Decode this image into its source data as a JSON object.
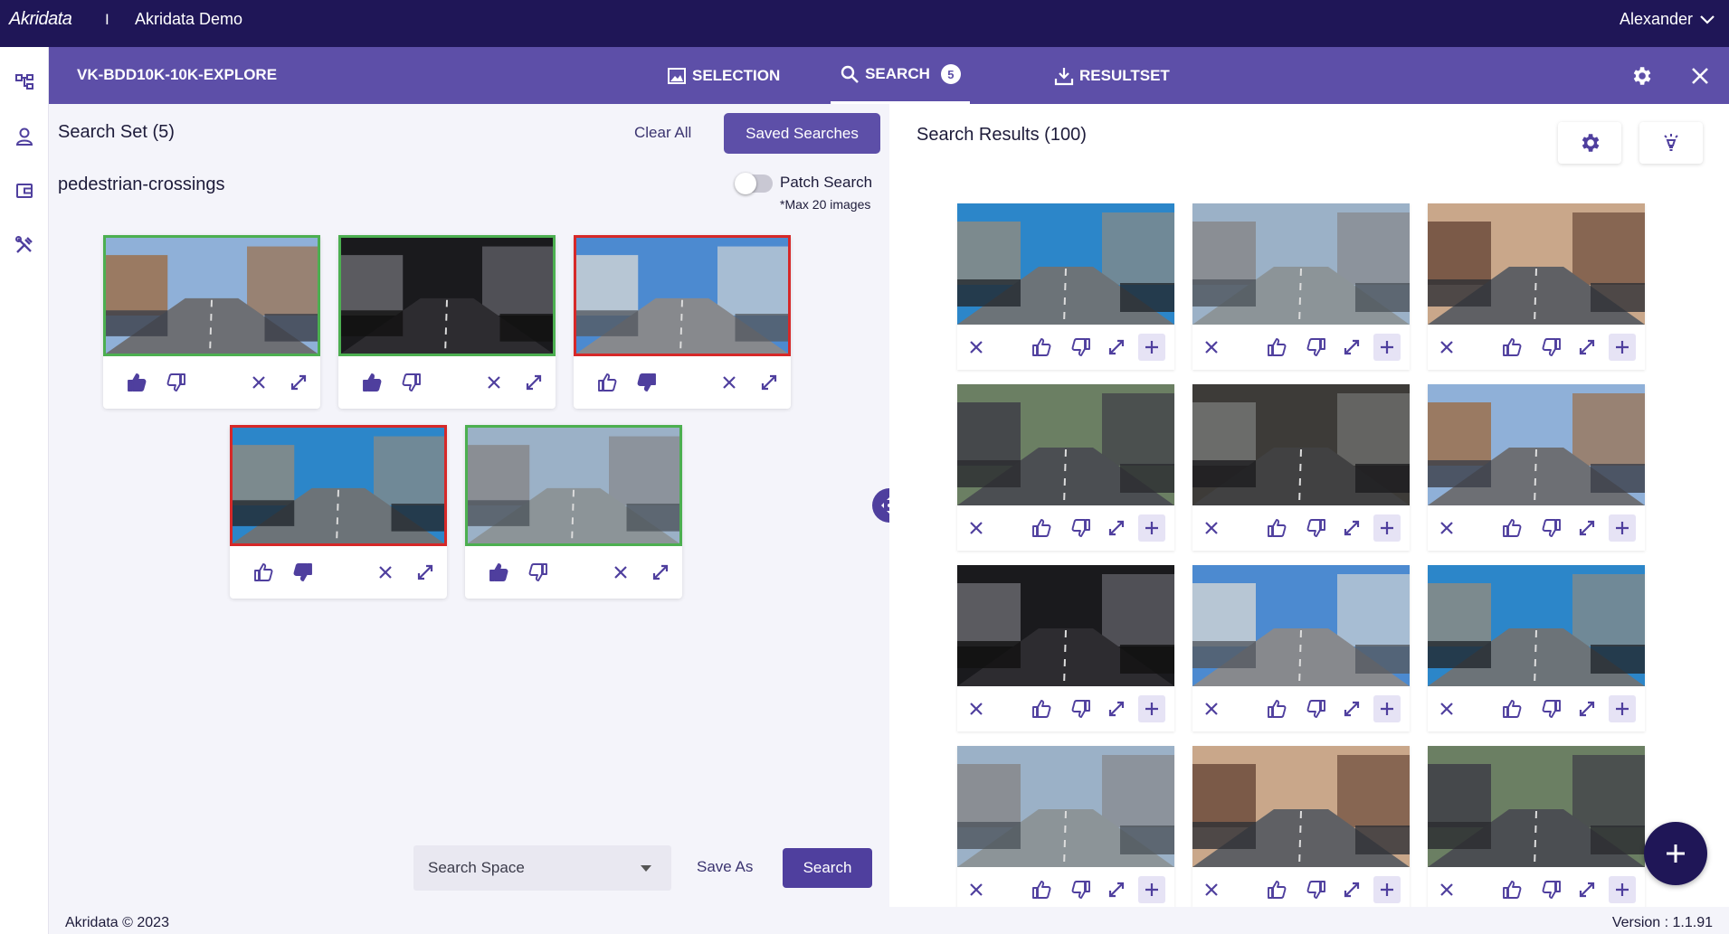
{
  "app": {
    "logo": "Akridata",
    "separator": "I",
    "name": "Akridata Demo",
    "user": "Alexander"
  },
  "project": {
    "title": "VK-BDD10K-10K-EXPLORE",
    "tabs": [
      {
        "label": "SELECTION",
        "icon": "image-icon"
      },
      {
        "label": "SEARCH",
        "icon": "search-icon",
        "badge": "5"
      },
      {
        "label": "RESULTSET",
        "icon": "download-icon"
      }
    ]
  },
  "search_set": {
    "title": "Search Set (5)",
    "clear_all": "Clear All",
    "saved_searches": "Saved Searches",
    "name": "pedestrian-crossings",
    "patch_search_label": "Patch Search",
    "max_note": "*Max 20 images",
    "items": [
      {
        "polarity": "positive",
        "scene": "crosswalk-buildings"
      },
      {
        "polarity": "positive",
        "scene": "night-truck"
      },
      {
        "polarity": "negative",
        "scene": "sky-road"
      },
      {
        "polarity": "negative",
        "scene": "blue-highway"
      },
      {
        "polarity": "positive",
        "scene": "city-street"
      }
    ],
    "search_space_placeholder": "Search Space",
    "save_as": "Save As",
    "search_button": "Search"
  },
  "results": {
    "title": "Search Results (100)"
  },
  "footer": {
    "copyright": "Akridata © 2023",
    "version": "Version : 1.1.91"
  },
  "colors": {
    "topbar": "#1f1657",
    "accent": "#5d4fa8",
    "positive": "#4caf50",
    "negative": "#d62828"
  }
}
